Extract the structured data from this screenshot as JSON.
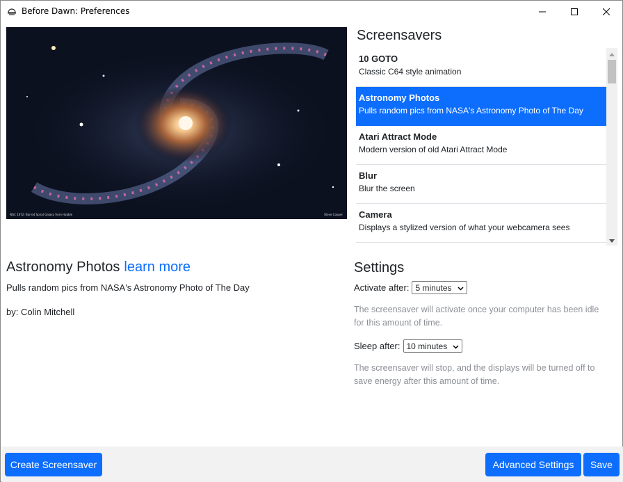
{
  "window": {
    "title": "Before Dawn: Preferences",
    "icons": {
      "app": "app-icon",
      "minimize": "minimize-icon",
      "maximize": "maximize-icon",
      "close": "close-icon"
    }
  },
  "preview": {
    "caption_left": "NGC 1672: Barred Spiral Galaxy from Hubble",
    "caption_right": "Steve Cooper"
  },
  "screensavers": {
    "heading": "Screensavers",
    "items": [
      {
        "name": "10 GOTO",
        "description": "Classic C64 style animation",
        "selected": false
      },
      {
        "name": "Astronomy Photos",
        "description": "Pulls random pics from NASA's Astronomy Photo of The Day",
        "selected": true
      },
      {
        "name": "Atari Attract Mode",
        "description": "Modern version of old Atari Attract Mode",
        "selected": false
      },
      {
        "name": "Blur",
        "description": "Blur the screen",
        "selected": false
      },
      {
        "name": "Camera",
        "description": "Displays a stylized version of what your webcamera sees",
        "selected": false
      }
    ]
  },
  "details": {
    "title": "Astronomy Photos",
    "learn_more": "learn more",
    "description": "Pulls random pics from NASA's Astronomy Photo of The Day",
    "author": "by: Colin Mitchell"
  },
  "settings": {
    "heading": "Settings",
    "activate_label": "Activate after:",
    "activate_value": "5 minutes",
    "activate_help": "The screensaver will activate once your computer has been idle for this amount of time.",
    "sleep_label": "Sleep after:",
    "sleep_value": "10 minutes",
    "sleep_help": "The screensaver will stop, and the displays will be turned off to save energy after this amount of time."
  },
  "footer": {
    "create": "Create Screensaver",
    "advanced": "Advanced Settings",
    "save": "Save"
  },
  "colors": {
    "accent": "#0d6efd",
    "footer_bg": "#f2f2f2",
    "muted_text": "#8c9096"
  }
}
